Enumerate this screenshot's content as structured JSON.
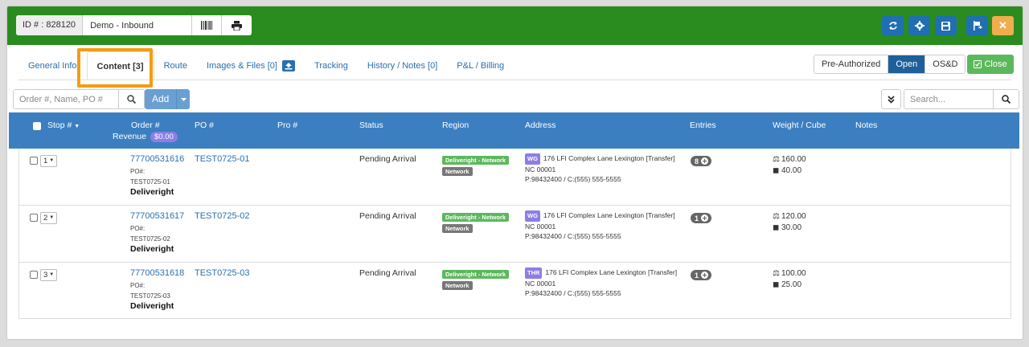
{
  "header": {
    "id_label": "ID # : 828120",
    "name_value": "Demo - Inbound",
    "colors": {
      "bar": "#2a8c1f",
      "blue_button": "#1f6fb2",
      "close_button": "#f0ad4e"
    },
    "icons": [
      "barcode-icon",
      "print-icon",
      "refresh-icon",
      "settings-icon",
      "save-icon",
      "flag-icon",
      "close-icon"
    ]
  },
  "tabs": [
    {
      "label": "General Info"
    },
    {
      "label": "Content [3]"
    },
    {
      "label": "Route"
    },
    {
      "label": "Images & Files [0]"
    },
    {
      "label": "Tracking"
    },
    {
      "label": "History / Notes [0]"
    },
    {
      "label": "P&L / Billing"
    }
  ],
  "status_toggle": {
    "options": [
      "Pre-Authorized",
      "Open",
      "OS&D"
    ],
    "selected": "Open"
  },
  "close_label": "Close",
  "toolbar": {
    "search_placeholder": "Order #, Name, PO #",
    "add_label": "Add",
    "right_search_placeholder": "Search..."
  },
  "table": {
    "headers": {
      "stop": "Stop #",
      "order": "Order #",
      "revenue": "Revenue",
      "revenue_value": "$0.00",
      "po": "PO #",
      "pro": "Pro #",
      "status": "Status",
      "region": "Region",
      "address": "Address",
      "entries": "Entries",
      "weight": "Weight / Cube",
      "notes": "Notes"
    },
    "rows": [
      {
        "stop": "1",
        "order": "77700531616",
        "po_label": "PO#:",
        "po_small": "TEST0725-01",
        "customer": "Deliveright",
        "po": "TEST0725-01",
        "status": "Pending Arrival",
        "region_primary": "Deliveright - Network",
        "region_secondary": "Network",
        "addr_tag": "WG",
        "addr_line1": "176 LFI Complex Lane Lexington [Transfer]",
        "addr_line2": "NC 00001",
        "addr_line3": "P:98432400 / C:(555) 555-5555",
        "entries": "8",
        "weight": "160.00",
        "cube": "40.00"
      },
      {
        "stop": "2",
        "order": "77700531617",
        "po_label": "PO#:",
        "po_small": "TEST0725-02",
        "customer": "Deliveright",
        "po": "TEST0725-02",
        "status": "Pending Arrival",
        "region_primary": "Deliveright - Network",
        "region_secondary": "Network",
        "addr_tag": "WG",
        "addr_line1": "176 LFI Complex Lane Lexington [Transfer]",
        "addr_line2": "NC 00001",
        "addr_line3": "P:98432400 / C:(555) 555-5555",
        "entries": "1",
        "weight": "120.00",
        "cube": "30.00"
      },
      {
        "stop": "3",
        "order": "77700531618",
        "po_label": "PO#:",
        "po_small": "TEST0725-03",
        "customer": "Deliveright",
        "po": "TEST0725-03",
        "status": "Pending Arrival",
        "region_primary": "Deliveright - Network",
        "region_secondary": "Network",
        "addr_tag": "THR",
        "addr_line1": "176 LFI Complex Lane Lexington [Transfer]",
        "addr_line2": "NC 00001",
        "addr_line3": "P:98432400 / C:(555) 555-5555",
        "entries": "1",
        "weight": "100.00",
        "cube": "25.00"
      }
    ]
  }
}
